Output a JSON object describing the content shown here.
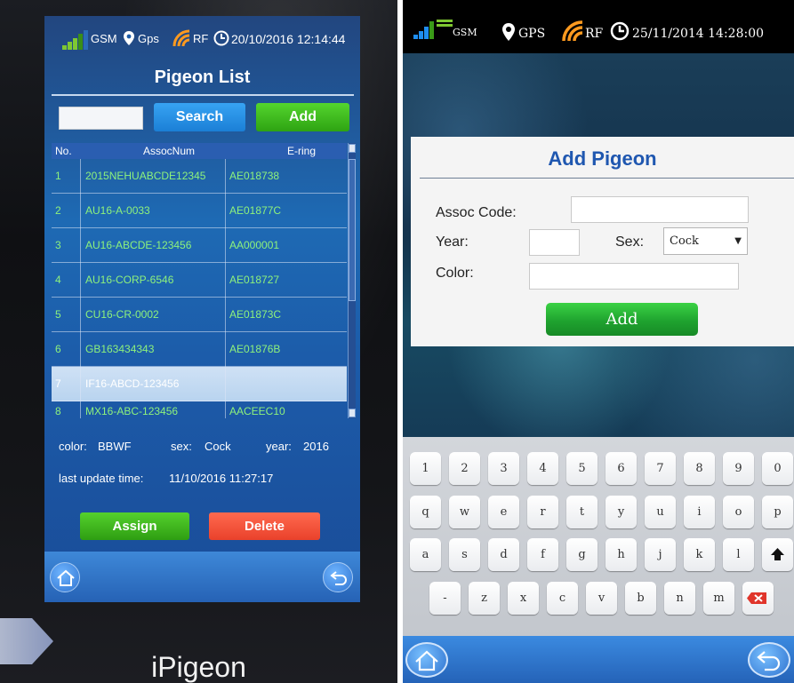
{
  "colors": {
    "accent": "#1f57b0",
    "green": "#2ea312",
    "red": "#e9412b",
    "list_text": "#8ef27c"
  },
  "left": {
    "status": {
      "gsm": "GSM",
      "gps": "Gps",
      "rf": "RF",
      "datetime": "20/10/2016 12:14:44"
    },
    "title": "Pigeon List",
    "search_button": "Search",
    "add_button": "Add",
    "columns": [
      "No.",
      "AssocNum",
      "E-ring"
    ],
    "rows": [
      {
        "no": "1",
        "assoc": "2015NEHUABCDE12345",
        "ering": "AE018738"
      },
      {
        "no": "2",
        "assoc": "AU16-A-0033",
        "ering": "AE01877C"
      },
      {
        "no": "3",
        "assoc": "AU16-ABCDE-123456",
        "ering": "AA000001"
      },
      {
        "no": "4",
        "assoc": "AU16-CORP-6546",
        "ering": "AE018727"
      },
      {
        "no": "5",
        "assoc": "CU16-CR-0002",
        "ering": "AE01873C"
      },
      {
        "no": "6",
        "assoc": "GB163434343",
        "ering": "AE01876B"
      },
      {
        "no": "7",
        "assoc": "IF16-ABCD-123456",
        "ering": ""
      },
      {
        "no": "8",
        "assoc": "MX16-ABC-123456",
        "ering": "AACEEC10"
      }
    ],
    "detail": {
      "color_label": "color:",
      "color_value": "BBWF",
      "sex_label": "sex:",
      "sex_value": "Cock",
      "year_label": "year:",
      "year_value": "2016",
      "update_label": "last update time:",
      "update_value": "11/10/2016 11:27:17"
    },
    "assign_button": "Assign",
    "delete_button": "Delete",
    "brand": "iPigeon"
  },
  "right": {
    "status": {
      "gsm": "GSM",
      "gps": "GPS",
      "rf": "RF",
      "datetime": "25/11/2014 14:28:00"
    },
    "dialog": {
      "title": "Add Pigeon",
      "assoc_label": "Assoc Code:",
      "year_label": "Year:",
      "sex_label": "Sex:",
      "sex_value": "Cock",
      "color_label": "Color:",
      "add_button": "Add"
    },
    "keyboard": {
      "row1": [
        "1",
        "2",
        "3",
        "4",
        "5",
        "6",
        "7",
        "8",
        "9",
        "0"
      ],
      "row2": [
        "q",
        "w",
        "e",
        "r",
        "t",
        "y",
        "u",
        "i",
        "o",
        "p"
      ],
      "row3": [
        "a",
        "s",
        "d",
        "f",
        "g",
        "h",
        "j",
        "k",
        "l"
      ],
      "row4": [
        "-",
        "z",
        "x",
        "c",
        "v",
        "b",
        "n",
        "m"
      ]
    }
  }
}
